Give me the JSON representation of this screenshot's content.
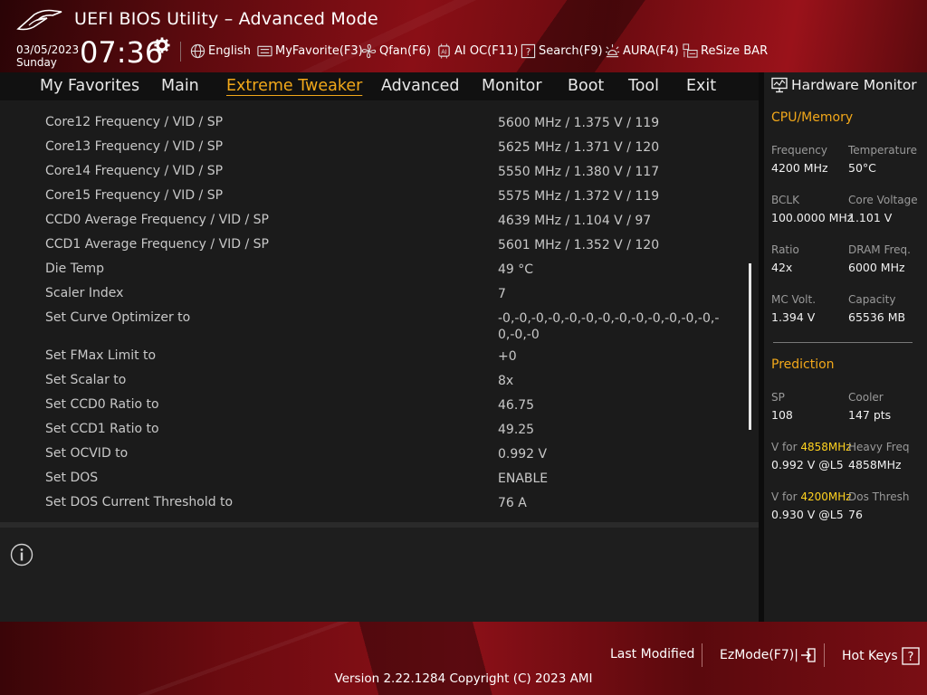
{
  "header": {
    "title": "UEFI BIOS Utility – Advanced Mode",
    "date": "03/05/2023",
    "day": "Sunday",
    "time": "07:36",
    "tools": [
      {
        "icon": "globe-icon",
        "label": "English"
      },
      {
        "icon": "keyboard-icon",
        "label": "MyFavorite(F3)"
      },
      {
        "icon": "fan-icon",
        "label": "Qfan(F6)"
      },
      {
        "icon": "ai-chip-icon",
        "label": "AI OC(F11)"
      },
      {
        "icon": "question-box-icon",
        "label": "Search(F9)"
      },
      {
        "icon": "aura-light-icon",
        "label": "AURA(F4)"
      },
      {
        "icon": "resize-bar-icon",
        "label": "ReSize BAR"
      }
    ]
  },
  "menu": {
    "items": [
      "My Favorites",
      "Main",
      "Extreme Tweaker",
      "Advanced",
      "Monitor",
      "Boot",
      "Tool",
      "Exit"
    ],
    "active": "Extreme Tweaker"
  },
  "settings": [
    {
      "label": "Core12 Frequency / VID / SP",
      "value": "5600 MHz / 1.375 V / 119"
    },
    {
      "label": "Core13 Frequency / VID / SP",
      "value": "5625 MHz / 1.371 V / 120"
    },
    {
      "label": "Core14 Frequency / VID / SP",
      "value": "5550 MHz / 1.380 V / 117"
    },
    {
      "label": "Core15 Frequency / VID / SP",
      "value": "5575 MHz / 1.372 V / 119"
    },
    {
      "label": "CCD0 Average Frequency / VID / SP",
      "value": "4639 MHz / 1.104 V / 97"
    },
    {
      "label": "CCD1 Average Frequency / VID / SP",
      "value": "5601 MHz / 1.352 V / 120"
    },
    {
      "label": "Die Temp",
      "value": "49 °C"
    },
    {
      "label": "Scaler Index",
      "value": "7"
    },
    {
      "label": "Set Curve Optimizer to",
      "value": "-0,-0,-0,-0,-0,-0,-0,-0,-0,-0,-0,-0,-0,-0,-0,-0"
    },
    {
      "label": "Set FMax Limit to",
      "value": "+0"
    },
    {
      "label": "Set Scalar to",
      "value": "8x"
    },
    {
      "label": "Set CCD0 Ratio to",
      "value": "46.75"
    },
    {
      "label": "Set CCD1 Ratio to",
      "value": "49.25"
    },
    {
      "label": "Set OCVID to",
      "value": "0.992 V"
    },
    {
      "label": "Set DOS",
      "value": "ENABLE"
    },
    {
      "label": "Set DOS Current Threshold to",
      "value": "76 A"
    }
  ],
  "hardware_monitor": {
    "title": "Hardware Monitor",
    "cpu_memory": {
      "heading": "CPU/Memory",
      "items": [
        {
          "label": "Frequency",
          "value": "4200 MHz"
        },
        {
          "label": "Temperature",
          "value": "50°C"
        },
        {
          "label": "BCLK",
          "value": "100.0000 MHz"
        },
        {
          "label": "Core Voltage",
          "value": "1.101 V"
        },
        {
          "label": "Ratio",
          "value": "42x"
        },
        {
          "label": "DRAM Freq.",
          "value": "6000 MHz"
        },
        {
          "label": "MC Volt.",
          "value": "1.394 V"
        },
        {
          "label": "Capacity",
          "value": "65536 MB"
        }
      ]
    },
    "prediction": {
      "heading": "Prediction",
      "sp_label": "SP",
      "sp_value": "108",
      "cooler_label": "Cooler",
      "cooler_value": "147 pts",
      "v1_prefix": "V for ",
      "v1_freq": "4858MHz",
      "v1_value": "0.992 V @L5",
      "heavy_label": "Heavy Freq",
      "heavy_value": "4858MHz",
      "v2_prefix": "V for ",
      "v2_freq": "4200MHz",
      "v2_value": "0.930 V @L5",
      "dos_label": "Dos Thresh",
      "dos_value": "76"
    }
  },
  "footer": {
    "last_modified": "Last Modified",
    "ezmode": "EzMode(F7)|",
    "hotkeys": "Hot Keys",
    "version": "Version 2.22.1284 Copyright (C) 2023 AMI"
  },
  "colors": {
    "accent": "#f2a81a",
    "highlight": "#ffd21f",
    "brand_red": "#8a0f16"
  }
}
